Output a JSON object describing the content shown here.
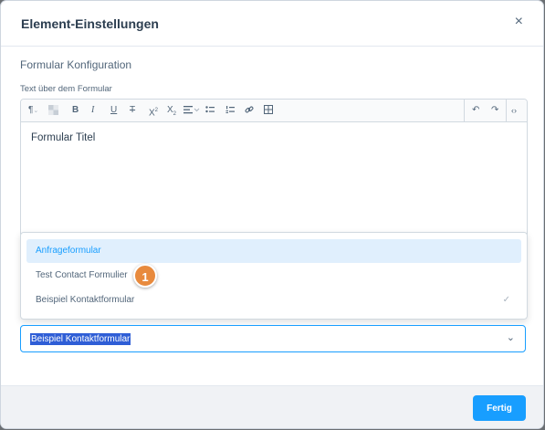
{
  "dialog": {
    "title": "Element-Einstellungen",
    "close_glyph": "×"
  },
  "section": {
    "title": "Formular Konfiguration"
  },
  "editor": {
    "label": "Text über dem Formular",
    "content": "Formular Titel",
    "toolbar": {
      "paragraph": "¶",
      "bold": "B",
      "italic": "I",
      "underline": "U",
      "strike": "T",
      "superscript": "X",
      "subscript": "X",
      "undo": "↶",
      "redo": "↷",
      "code": "‹›"
    }
  },
  "dropdown": {
    "options": [
      {
        "label": "Anfrageformular",
        "highlighted": true
      },
      {
        "label": "Test Contact Formulier",
        "highlighted": false
      },
      {
        "label": "Beispiel Kontaktformular",
        "selected": true
      }
    ],
    "check_glyph": "✓"
  },
  "callout": {
    "number": "1"
  },
  "select": {
    "value": "Beispiel Kontaktformular",
    "chevron": "⌄"
  },
  "footer": {
    "done_label": "Fertig"
  },
  "colors": {
    "accent": "#189eff",
    "badge": "#e88a3d",
    "highlight_bg": "#e0effd",
    "text_selection": "#2f5ed6"
  }
}
